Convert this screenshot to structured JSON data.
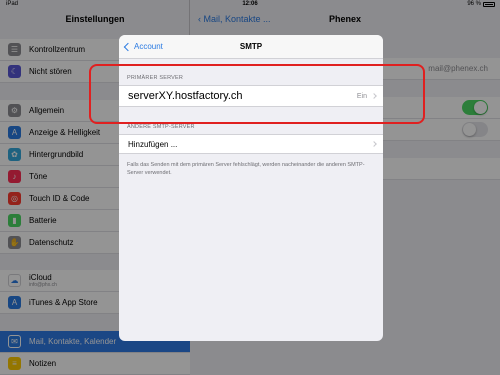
{
  "status": {
    "carrier": "iPad",
    "time": "12:06",
    "battery": "96 %"
  },
  "master": {
    "title": "Einstellungen",
    "items": [
      {
        "label": "Kontrollzentrum",
        "icon": "control-center-icon",
        "color": "#8e8e93"
      },
      {
        "label": "Nicht stören",
        "icon": "moon-icon",
        "color": "#5856d6"
      },
      {
        "label": "Allgemein",
        "icon": "gear-icon",
        "color": "#8e8e93"
      },
      {
        "label": "Anzeige & Helligkeit",
        "icon": "brightness-icon",
        "color": "#2a7ae2"
      },
      {
        "label": "Hintergrundbild",
        "icon": "wallpaper-icon",
        "color": "#34aadc"
      },
      {
        "label": "Töne",
        "icon": "speaker-icon",
        "color": "#ff2d55"
      },
      {
        "label": "Touch ID & Code",
        "icon": "fingerprint-icon",
        "color": "#ff3b30"
      },
      {
        "label": "Batterie",
        "icon": "battery-icon",
        "color": "#4cd964"
      },
      {
        "label": "Datenschutz",
        "icon": "hand-icon",
        "color": "#8e8e93"
      },
      {
        "label": "iCloud",
        "sub": "info@phx.ch",
        "icon": "cloud-icon",
        "color": "#ffffff"
      },
      {
        "label": "iTunes & App Store",
        "icon": "appstore-icon",
        "color": "#2a7ae2"
      },
      {
        "label": "Mail, Kontakte, Kalender",
        "icon": "mail-icon",
        "color": "#2a7ae2"
      },
      {
        "label": "Notizen",
        "icon": "notes-icon",
        "color": "#ffcc00"
      }
    ]
  },
  "detail": {
    "back_label": "Mail, Kontakte ...",
    "title": "Phenex",
    "email": "mail@phenex.ch"
  },
  "modal": {
    "back_label": "Account",
    "title": "SMTP",
    "primary_header": "PRIMÄRER SERVER",
    "primary_server": "serverXY.hostfactory.ch",
    "primary_status": "Ein",
    "other_header": "ANDERE SMTP-SERVER",
    "add_label": "Hinzufügen ...",
    "footer": "Falls das Senden mit dem primären Server fehlschlägt, werden nacheinander die anderen SMTP-Server verwendet."
  }
}
